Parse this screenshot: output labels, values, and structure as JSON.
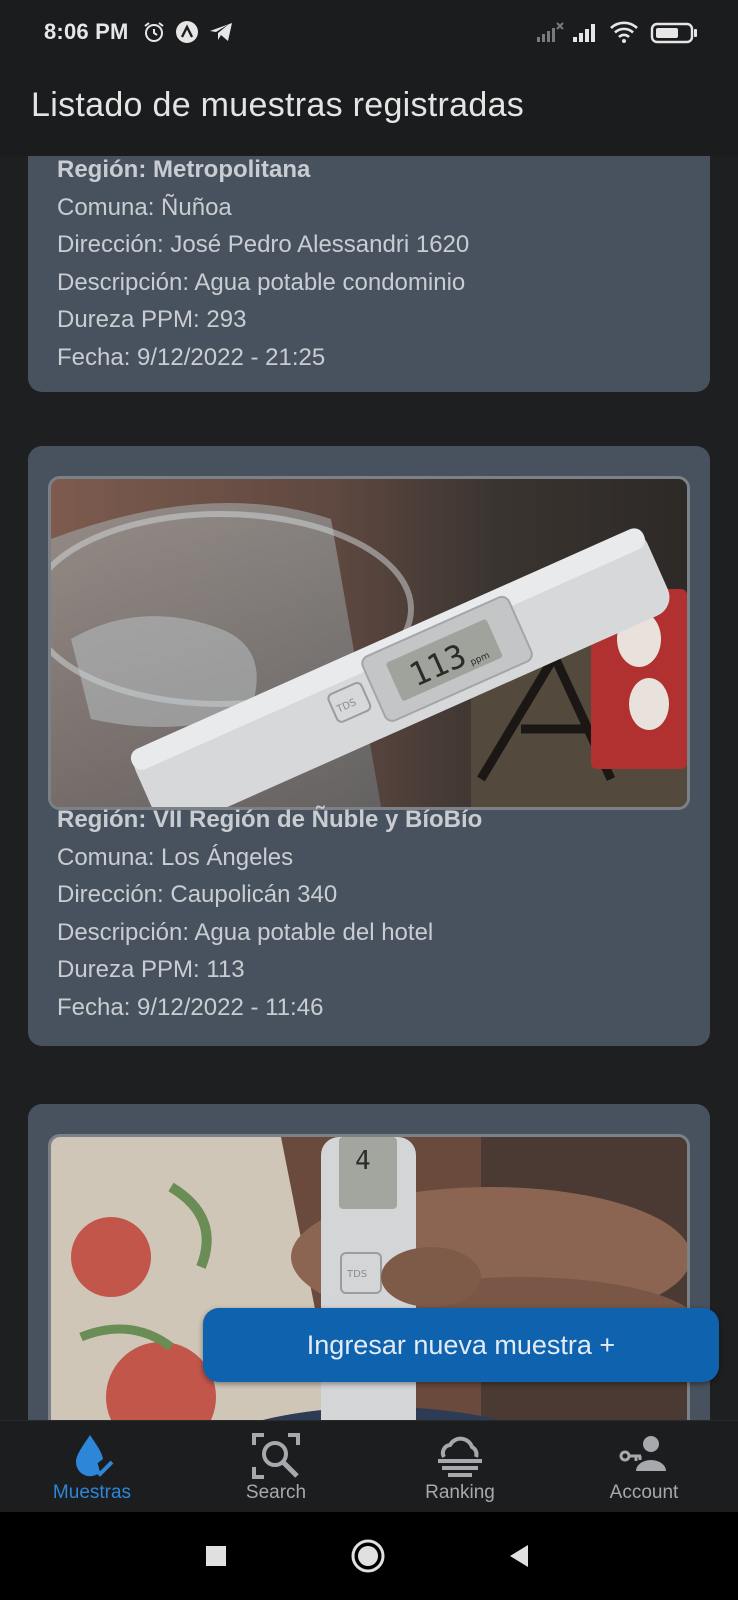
{
  "status_bar": {
    "time": "8:06 PM"
  },
  "app_bar": {
    "title": "Listado de muestras registradas"
  },
  "samples": [
    {
      "region": "Región: Metropolitana",
      "comuna": "Comuna: Ñuñoa",
      "direccion": "Dirección: José Pedro Alessandri 1620",
      "descripcion": "Descripción: Agua potable condominio",
      "dureza": "Dureza PPM: 293",
      "fecha": "Fecha:  9/12/2022 - 21:25"
    },
    {
      "region": "Región: VII Región de Ñuble y BíoBío",
      "comuna": "Comuna: Los Ángeles",
      "direccion": "Dirección: Caupolicán 340",
      "descripcion": "Descripción: Agua potable del hotel",
      "dureza": "Dureza PPM: 113",
      "fecha": "Fecha:  9/12/2022 - 11:46",
      "photo_reading": "113",
      "photo_unit": "ppm",
      "photo_brand": "TDS"
    },
    {
      "photo_reading": "4",
      "photo_brand": "TDS"
    }
  ],
  "fab": {
    "label": "Ingresar nueva muestra +"
  },
  "bottom_nav": {
    "items": [
      {
        "label": "Muestras",
        "icon": "water-drop-check-icon",
        "active": true
      },
      {
        "label": "Search",
        "icon": "search-icon",
        "active": false
      },
      {
        "label": "Ranking",
        "icon": "ranking-cloud-icon",
        "active": false
      },
      {
        "label": "Account",
        "icon": "account-key-icon",
        "active": false
      }
    ]
  },
  "colors": {
    "accent": "#2d86d8",
    "fab": "#0f62ad",
    "card": "#48525e",
    "background": "#1e1f21"
  }
}
